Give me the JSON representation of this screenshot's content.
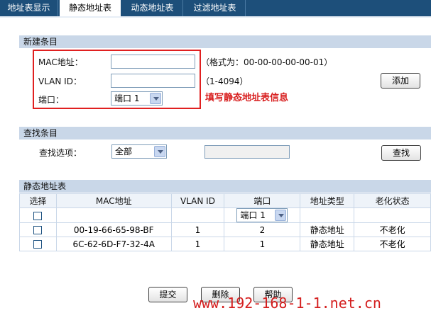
{
  "tabs": [
    {
      "label": "地址表显示",
      "active": false
    },
    {
      "label": "静态地址表",
      "active": true
    },
    {
      "label": "动态地址表",
      "active": false
    },
    {
      "label": "过滤地址表",
      "active": false
    }
  ],
  "new_entry": {
    "title": "新建条目",
    "mac_label": "MAC地址：",
    "mac_value": "",
    "mac_hint": "（格式为：00-00-00-00-00-01）",
    "vlan_label": "VLAN ID：",
    "vlan_value": "",
    "vlan_hint": "（1-4094）",
    "port_label": "端口：",
    "port_selected": "端口 1",
    "add_button": "添加",
    "annotation": "填写静态地址表信息"
  },
  "search": {
    "title": "查找条目",
    "option_label": "查找选项：",
    "option_selected": "全部",
    "query_value": "",
    "button": "查找"
  },
  "static_table": {
    "title": "静态地址表",
    "columns": [
      "选择",
      "MAC地址",
      "VLAN ID",
      "端口",
      "地址类型",
      "老化状态"
    ],
    "filter_port": "端口 1",
    "rows": [
      {
        "mac": "00-19-66-65-98-BF",
        "vlan": "1",
        "port": "2",
        "type": "静态地址",
        "aging": "不老化"
      },
      {
        "mac": "6C-62-6D-F7-32-4A",
        "vlan": "1",
        "port": "1",
        "type": "静态地址",
        "aging": "不老化"
      }
    ]
  },
  "footer_buttons": {
    "submit": "提交",
    "delete": "删除",
    "help": "帮助"
  },
  "watermark": "www.192-168-1-1.net.cn",
  "colors": {
    "tab_bar": "#1d4f7a",
    "panel_header": "#c9d7e8",
    "annotation": "#d81e1e"
  }
}
